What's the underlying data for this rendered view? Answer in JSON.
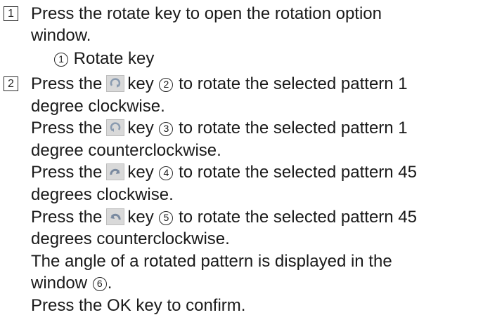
{
  "step1": {
    "number": "1",
    "line1": "Press the rotate key to open the rotation option",
    "line2": "window.",
    "callout_num": "1",
    "callout_text": "Rotate key"
  },
  "step2": {
    "number": "2",
    "rows": [
      {
        "pre": "Press the",
        "post_key": "key",
        "num": "2",
        "post": "to rotate the selected pattern 1"
      },
      {
        "text": "degree clockwise."
      },
      {
        "pre": "Press the",
        "post_key": "key",
        "num": "3",
        "post": "to rotate the selected pattern 1"
      },
      {
        "text": "degree counterclockwise."
      },
      {
        "pre": "Press the",
        "post_key": "key",
        "num": "4",
        "post": "to rotate the selected pattern 45"
      },
      {
        "text": "degrees clockwise."
      },
      {
        "pre": "Press the",
        "post_key": "key",
        "num": "5",
        "post": "to rotate the selected pattern 45"
      },
      {
        "text": "degrees counterclockwise."
      },
      {
        "text": "The angle of a rotated pattern is displayed in the"
      },
      {
        "text_pre": "window",
        "num": "6",
        "text_post": "."
      },
      {
        "text": "Press the OK key to confirm."
      }
    ],
    "icons": [
      "rotate-cw-1-icon",
      "rotate-ccw-1-icon",
      "rotate-cw-45-icon",
      "rotate-ccw-45-icon"
    ]
  }
}
